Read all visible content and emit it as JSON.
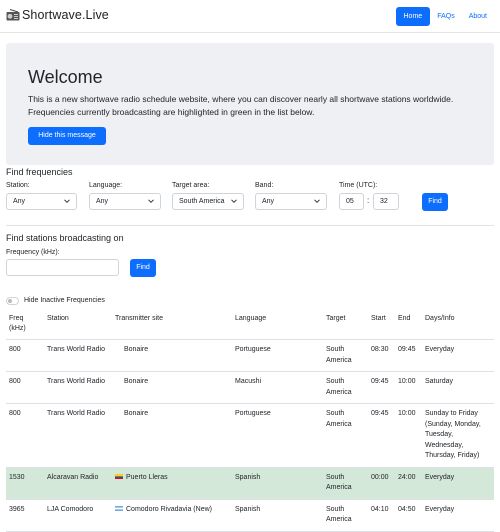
{
  "navbar": {
    "brand": "Shortwave.Live",
    "brand_icon": "radio-icon",
    "links": [
      {
        "label": "Home",
        "active": true
      },
      {
        "label": "FAQs",
        "active": false
      },
      {
        "label": "About",
        "active": false
      }
    ],
    "accent": "#0d6efd"
  },
  "jumbotron": {
    "title": "Welcome",
    "text": "This is a new shortwave radio schedule website, where you can discover nearly all shortwave stations worldwide. Frequencies currently broadcasting are highlighted in green in the list below.",
    "button": "Hide this message"
  },
  "find_frequencies": {
    "title": "Find frequencies",
    "station": {
      "label": "Station:",
      "value": "Any"
    },
    "language": {
      "label": "Language:",
      "value": "Any"
    },
    "target": {
      "label": "Target area:",
      "value": "South America"
    },
    "band": {
      "label": "Band:",
      "value": "Any"
    },
    "time": {
      "label": "Time (UTC):",
      "hour": "05",
      "sep": ":",
      "minute": "32"
    },
    "button": "Find"
  },
  "find_stations": {
    "title": "Find stations broadcasting on",
    "label": "Frequency (kHz):",
    "value": "",
    "button": "Find"
  },
  "toggle": {
    "label": "Hide Inactive Frequencies",
    "on": false
  },
  "table": {
    "headers": [
      "Freq (kHz)",
      "Station",
      "Transmitter site",
      "Language",
      "Target",
      "Start",
      "End",
      "Days/Info"
    ],
    "highlight_color": "#d4e8d9",
    "rows": [
      {
        "freq": "800",
        "station": "Trans World Radio",
        "site": "Bonaire",
        "flag": "",
        "language": "Portuguese",
        "target": "South America",
        "start": "08:30",
        "end": "09:45",
        "days": "Everyday",
        "live": false
      },
      {
        "freq": "800",
        "station": "Trans World Radio",
        "site": "Bonaire",
        "flag": "",
        "language": "Macushi",
        "target": "South America",
        "start": "09:45",
        "end": "10:00",
        "days": "Saturday",
        "live": false
      },
      {
        "freq": "800",
        "station": "Trans World Radio",
        "site": "Bonaire",
        "flag": "",
        "language": "Portuguese",
        "target": "South America",
        "start": "09:45",
        "end": "10:00",
        "days": "Sunday to Friday (Sunday, Monday, Tuesday, Wednesday, Thursday, Friday)",
        "live": false
      },
      {
        "freq": "1530",
        "station": "Alcaravan Radio",
        "site": "Puerto Lleras",
        "flag": "colombia-flag-icon",
        "language": "Spanish",
        "target": "South America",
        "start": "00:00",
        "end": "24:00",
        "days": "Everyday",
        "live": true
      },
      {
        "freq": "3965",
        "station": "LJA Comodoro",
        "site": "Comodoro Rivadavia (New)",
        "flag": "argentina-flag-icon",
        "language": "Spanish",
        "target": "South America",
        "start": "04:10",
        "end": "04:50",
        "days": "Everyday",
        "live": false
      }
    ]
  }
}
